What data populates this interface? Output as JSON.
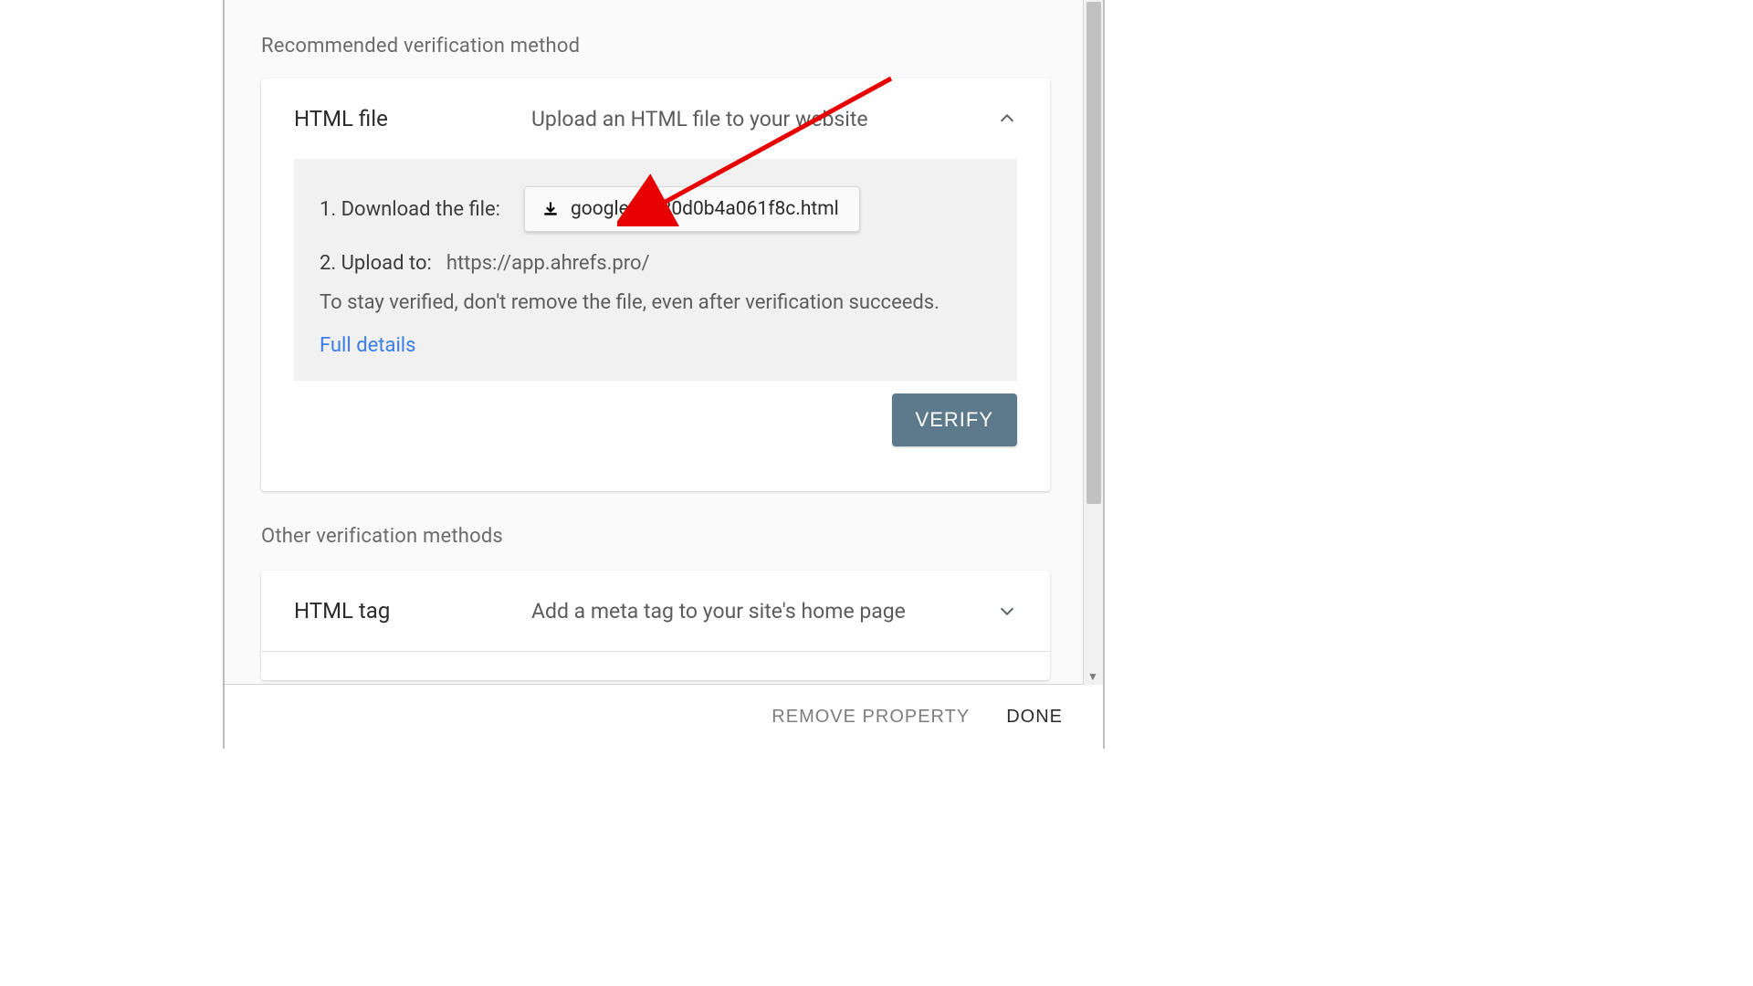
{
  "sections": {
    "recommended_label": "Recommended verification method",
    "other_label": "Other verification methods"
  },
  "html_file": {
    "title": "HTML file",
    "desc": "Upload an HTML file to your website",
    "step1_label": "1. Download the file:",
    "download_filename": "google15e20d0b4a061f8c.html",
    "step2_label": "2. Upload to:",
    "step2_target": "https://app.ahrefs.pro/",
    "note": "To stay verified, don't remove the file, even after verification succeeds.",
    "full_details": "Full details",
    "verify": "VERIFY"
  },
  "html_tag": {
    "title": "HTML tag",
    "desc": "Add a meta tag to your site's home page"
  },
  "footer": {
    "remove": "REMOVE PROPERTY",
    "done": "DONE"
  }
}
